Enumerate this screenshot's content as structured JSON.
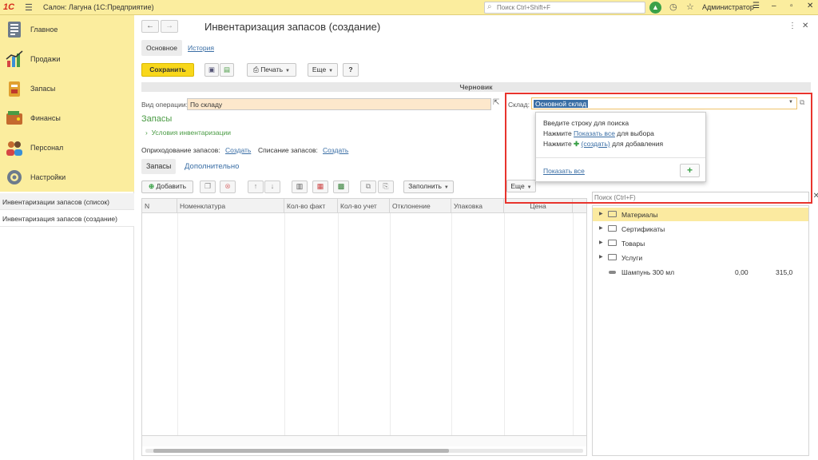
{
  "app": {
    "logo": "1С",
    "title": "Салон: Лагуна  (1С:Предприятие)",
    "search_placeholder": "Поиск Ctrl+Shift+F",
    "user": "Администратор"
  },
  "sidebar": {
    "items": [
      {
        "label": "Главное",
        "icon": "home-icon"
      },
      {
        "label": "Продажи",
        "icon": "sales-chart-icon"
      },
      {
        "label": "Запасы",
        "icon": "inventory-icon"
      },
      {
        "label": "Финансы",
        "icon": "wallet-icon"
      },
      {
        "label": "Персонал",
        "icon": "people-icon"
      },
      {
        "label": "Настройки",
        "icon": "gear-icon"
      }
    ],
    "open_windows": [
      "Инвентаризации запасов (список)",
      "Инвентаризация запасов (создание)"
    ]
  },
  "form": {
    "title": "Инвентаризация запасов (создание)",
    "tabs": {
      "main": "Основное",
      "history": "История"
    },
    "toolbar": {
      "save": "Сохранить",
      "print": "Печать",
      "more": "Еще",
      "help": "?"
    },
    "status": "Черновик",
    "operation_label": "Вид операции:",
    "operation_value": "По складу",
    "warehouse_label": "Склад:",
    "warehouse_value": "Основной склад",
    "section_title": "Запасы",
    "conditions_link": "Условия инвентаризации",
    "posting_label": "Оприходование запасов:",
    "posting_link": "Создать",
    "writeoff_label": "Списание запасов:",
    "writeoff_link": "Создать"
  },
  "popup": {
    "line1": "Введите строку для поиска",
    "line2_pre": "Нажмите ",
    "line2_link": "Показать все",
    "line2_post": " для выбора",
    "line3_pre": "Нажмите ",
    "line3_plus": "✚",
    "line3_link": "(создать)",
    "line3_post": " для добавления",
    "show_all": "Показать все",
    "add": "+"
  },
  "subtabs": {
    "active": "Запасы",
    "other": "Дополнительно"
  },
  "table_toolbar": {
    "add": "Добавить",
    "fill": "Заполнить",
    "more": "Еще"
  },
  "table": {
    "columns": [
      "N",
      "Номенклатура",
      "Кол-во факт",
      "Кол-во учет",
      "Отклонение",
      "Упаковка",
      "Цена"
    ]
  },
  "right_panel": {
    "search_placeholder": "Поиск (Ctrl+F)",
    "tree": [
      {
        "name": "Материалы",
        "type": "folder",
        "selected": true
      },
      {
        "name": "Сертификаты",
        "type": "folder"
      },
      {
        "name": "Товары",
        "type": "folder"
      },
      {
        "name": "Услуги",
        "type": "folder"
      },
      {
        "name": "Шампунь 300 мл",
        "type": "item",
        "qty": "0,00",
        "price": "315,0"
      }
    ]
  },
  "colors": {
    "accent_yellow": "#fbed9e",
    "save_button": "#f8d71b",
    "link": "#3a6ea5",
    "green": "#4a9b44",
    "highlight": "#e8342d"
  }
}
